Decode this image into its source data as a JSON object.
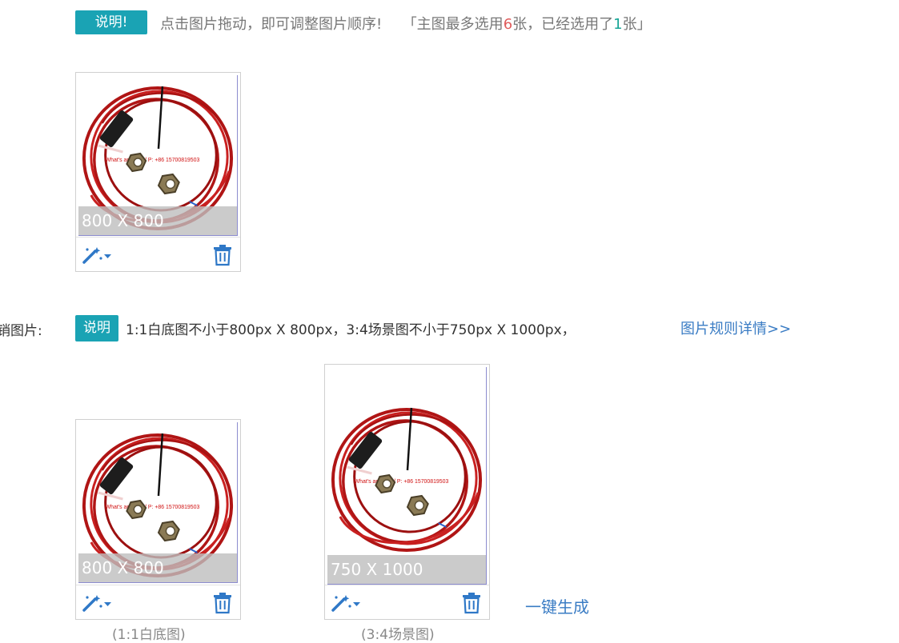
{
  "main_section": {
    "badge": "说明!",
    "hint": "点击图片拖动，即可调整图片顺序!",
    "quota_prefix": "「主图最多选用",
    "quota_max": "6",
    "quota_mid": "张，已经选用了",
    "quota_used": "1",
    "quota_suffix": "张」",
    "image": {
      "size_label": "800 X 800"
    }
  },
  "marketing_section": {
    "label": "销图片:",
    "badge": "说明",
    "rule": "1:1白底图不小于800px X 800px，3:4场景图不小于750px X 1000px，",
    "rule_link": "图片规则详情>>",
    "images": [
      {
        "size_label": "800 X 800",
        "caption": "(1:1白底图)"
      },
      {
        "size_label": "750 X 1000",
        "caption": "(3:4场景图)"
      }
    ],
    "generate_link": "一键生成"
  },
  "colors": {
    "badge": "#1aa3b4",
    "link": "#3a7cc4",
    "quota_max": "#e05c5c",
    "quota_used": "#17a596",
    "icon": "#2f78c7",
    "cable": "#b01515"
  },
  "icons": [
    "magic-wand-dropdown-icon",
    "trash-icon"
  ]
}
